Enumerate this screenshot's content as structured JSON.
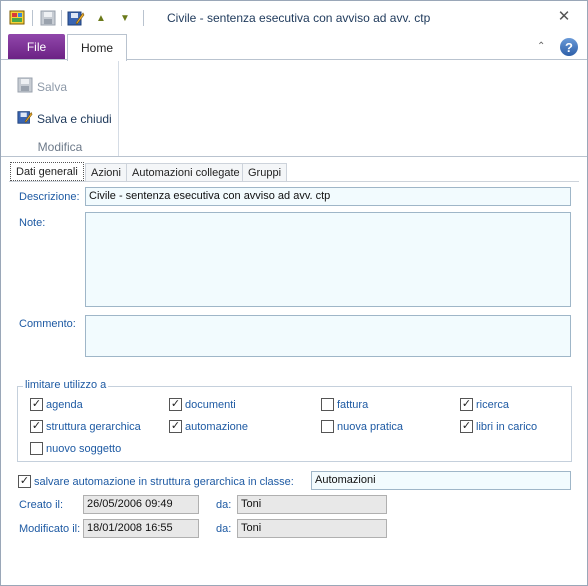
{
  "window": {
    "title": "Civile - sentenza esecutiva con avviso ad avv. ctp",
    "close_glyph": "✕"
  },
  "quick_access": {
    "icons": [
      "app-icon",
      "save-icon",
      "save-close-icon",
      "move-up-icon",
      "move-down-icon"
    ],
    "up_glyph": "▲",
    "down_glyph": "▼"
  },
  "ribbon_tabs": {
    "file": "File",
    "home": "Home",
    "help_glyph": "?",
    "collapse_glyph": "⌃"
  },
  "ribbon": {
    "save_label": "Salva",
    "save_close_label": "Salva e chiudi",
    "group_label": "Modifica"
  },
  "tabs": [
    "Dati generali",
    "Azioni",
    "Automazioni collegate",
    "Gruppi"
  ],
  "form": {
    "descrizione_label": "Descrizione:",
    "descrizione_value": "Civile - sentenza esecutiva con avviso ad avv. ctp",
    "note_label": "Note:",
    "note_value": "",
    "commento_label": "Commento:",
    "commento_value": "",
    "limit_group_title": "limitare utilizzo a",
    "checkboxes": [
      {
        "label": "agenda",
        "checked": true
      },
      {
        "label": "documenti",
        "checked": true
      },
      {
        "label": "fattura",
        "checked": false
      },
      {
        "label": "ricerca",
        "checked": true
      },
      {
        "label": "struttura gerarchica",
        "checked": true
      },
      {
        "label": "automazione",
        "checked": true
      },
      {
        "label": "nuova pratica",
        "checked": false
      },
      {
        "label": "libri in carico",
        "checked": true
      },
      {
        "label": "nuovo soggetto",
        "checked": false
      }
    ],
    "save_in_class_label": "salvare automazione in struttura gerarchica in classe:",
    "save_in_class_checked": true,
    "save_in_class_value": "Automazioni",
    "creato_label": "Creato il:",
    "creato_value": "26/05/2006 09:49",
    "creato_da_label": "da:",
    "creato_da_value": "Toni",
    "modificato_label": "Modificato il:",
    "modificato_value": "18/01/2008 16:55",
    "modificato_da_label": "da:",
    "modificato_da_value": "Toni"
  },
  "colors": {
    "file_tab": "#7a2d94",
    "label_blue": "#1e5aa3",
    "input_bg": "#f2fbfe"
  }
}
